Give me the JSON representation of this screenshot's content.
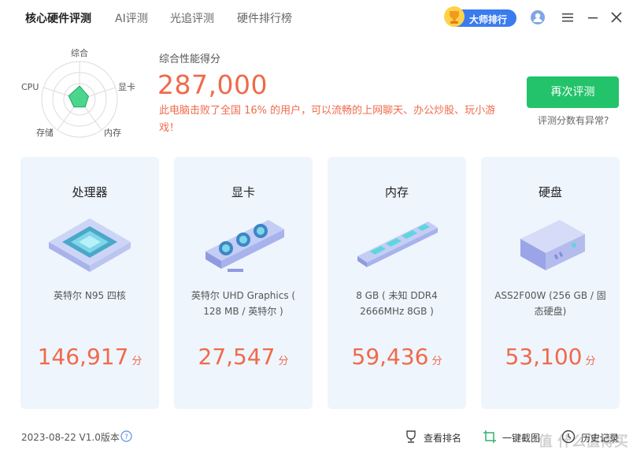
{
  "nav": {
    "tabs": [
      {
        "label": "核心硬件评测",
        "active": true
      },
      {
        "label": "AI评测",
        "active": false
      },
      {
        "label": "光追评测",
        "active": false
      },
      {
        "label": "硬件排行榜",
        "active": false
      }
    ],
    "master_rank_label": "大师排行",
    "icons": [
      "trophy-icon",
      "user-icon",
      "menu-icon",
      "minimize-icon",
      "close-icon"
    ]
  },
  "overall": {
    "radar_axes": [
      "综合",
      "显卡",
      "内存",
      "存储",
      "CPU"
    ],
    "radar_values": [
      0.35,
      0.25,
      0.25,
      0.25,
      0.3
    ],
    "label": "综合性能得分",
    "score": "287,000",
    "description": "此电脑击败了全国 16% 的用户，可以流畅的上网聊天、办公炒股、玩小游戏！",
    "retest_button": "再次评测",
    "anomaly_link": "评测分数有异常?"
  },
  "cards": [
    {
      "title": "处理器",
      "desc": "英特尔 N95 四核",
      "score": "146,917",
      "unit": "分",
      "icon": "cpu-chip-icon"
    },
    {
      "title": "显卡",
      "desc": "英特尔 UHD Graphics ( 128 MB / 英特尔 )",
      "score": "27,547",
      "unit": "分",
      "icon": "graphics-card-icon"
    },
    {
      "title": "内存",
      "desc": "8 GB ( 未知 DDR4 2666MHz 8GB )",
      "score": "59,436",
      "unit": "分",
      "icon": "ram-stick-icon"
    },
    {
      "title": "硬盘",
      "desc": "ASS2F00W (256 GB / 固态硬盘)",
      "score": "53,100",
      "unit": "分",
      "icon": "drive-icon"
    }
  ],
  "footer": {
    "version": "2023-08-22 V1.0版本",
    "actions": [
      {
        "label": "查看排名",
        "icon": "trophy-outline-icon"
      },
      {
        "label": "一键截图",
        "icon": "screenshot-icon"
      },
      {
        "label": "历史记录",
        "icon": "history-icon"
      }
    ],
    "watermark": "值 什么值得买"
  },
  "colors": {
    "accent": "#f06a4a",
    "primary_button": "#22c36a",
    "card_bg": "#eef5fd",
    "badge": "#3a7bf0"
  }
}
